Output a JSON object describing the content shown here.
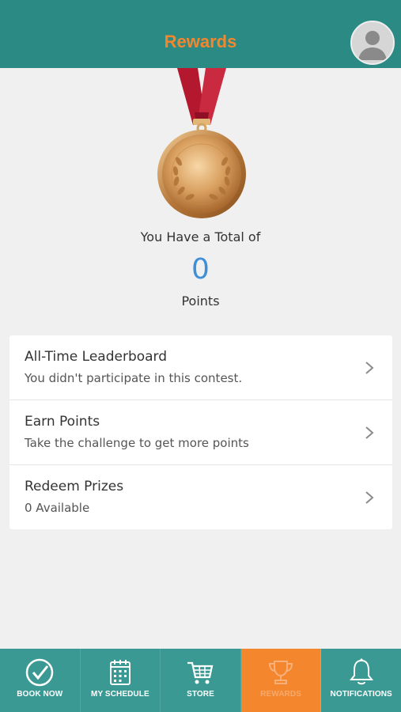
{
  "header": {
    "title": "Rewards"
  },
  "summary": {
    "total_label": "You Have a Total of",
    "points_value": "0",
    "points_label": "Points"
  },
  "list": {
    "items": [
      {
        "title": "All-Time Leaderboard",
        "subtitle": "You didn't participate in this contest.",
        "icon": "chevron-right-icon"
      },
      {
        "title": "Earn Points",
        "subtitle": "Take the challenge to get more points",
        "icon": "chevron-right-icon"
      },
      {
        "title": "Redeem Prizes",
        "subtitle": "0 Available",
        "icon": "chevron-right-icon"
      }
    ]
  },
  "nav": {
    "items": [
      {
        "label": "BOOK NOW",
        "icon": "check-circle-icon",
        "active": false
      },
      {
        "label": "MY SCHEDULE",
        "icon": "calendar-icon",
        "active": false
      },
      {
        "label": "STORE",
        "icon": "cart-icon",
        "active": false
      },
      {
        "label": "REWARDS",
        "icon": "trophy-icon",
        "active": true
      },
      {
        "label": "NOTIFICATIONS",
        "icon": "bell-icon",
        "active": false
      }
    ]
  },
  "colors": {
    "header_bg": "#2b8a83",
    "nav_bg": "#3a9a93",
    "accent": "#f4862e",
    "points": "#3f8fd8"
  }
}
